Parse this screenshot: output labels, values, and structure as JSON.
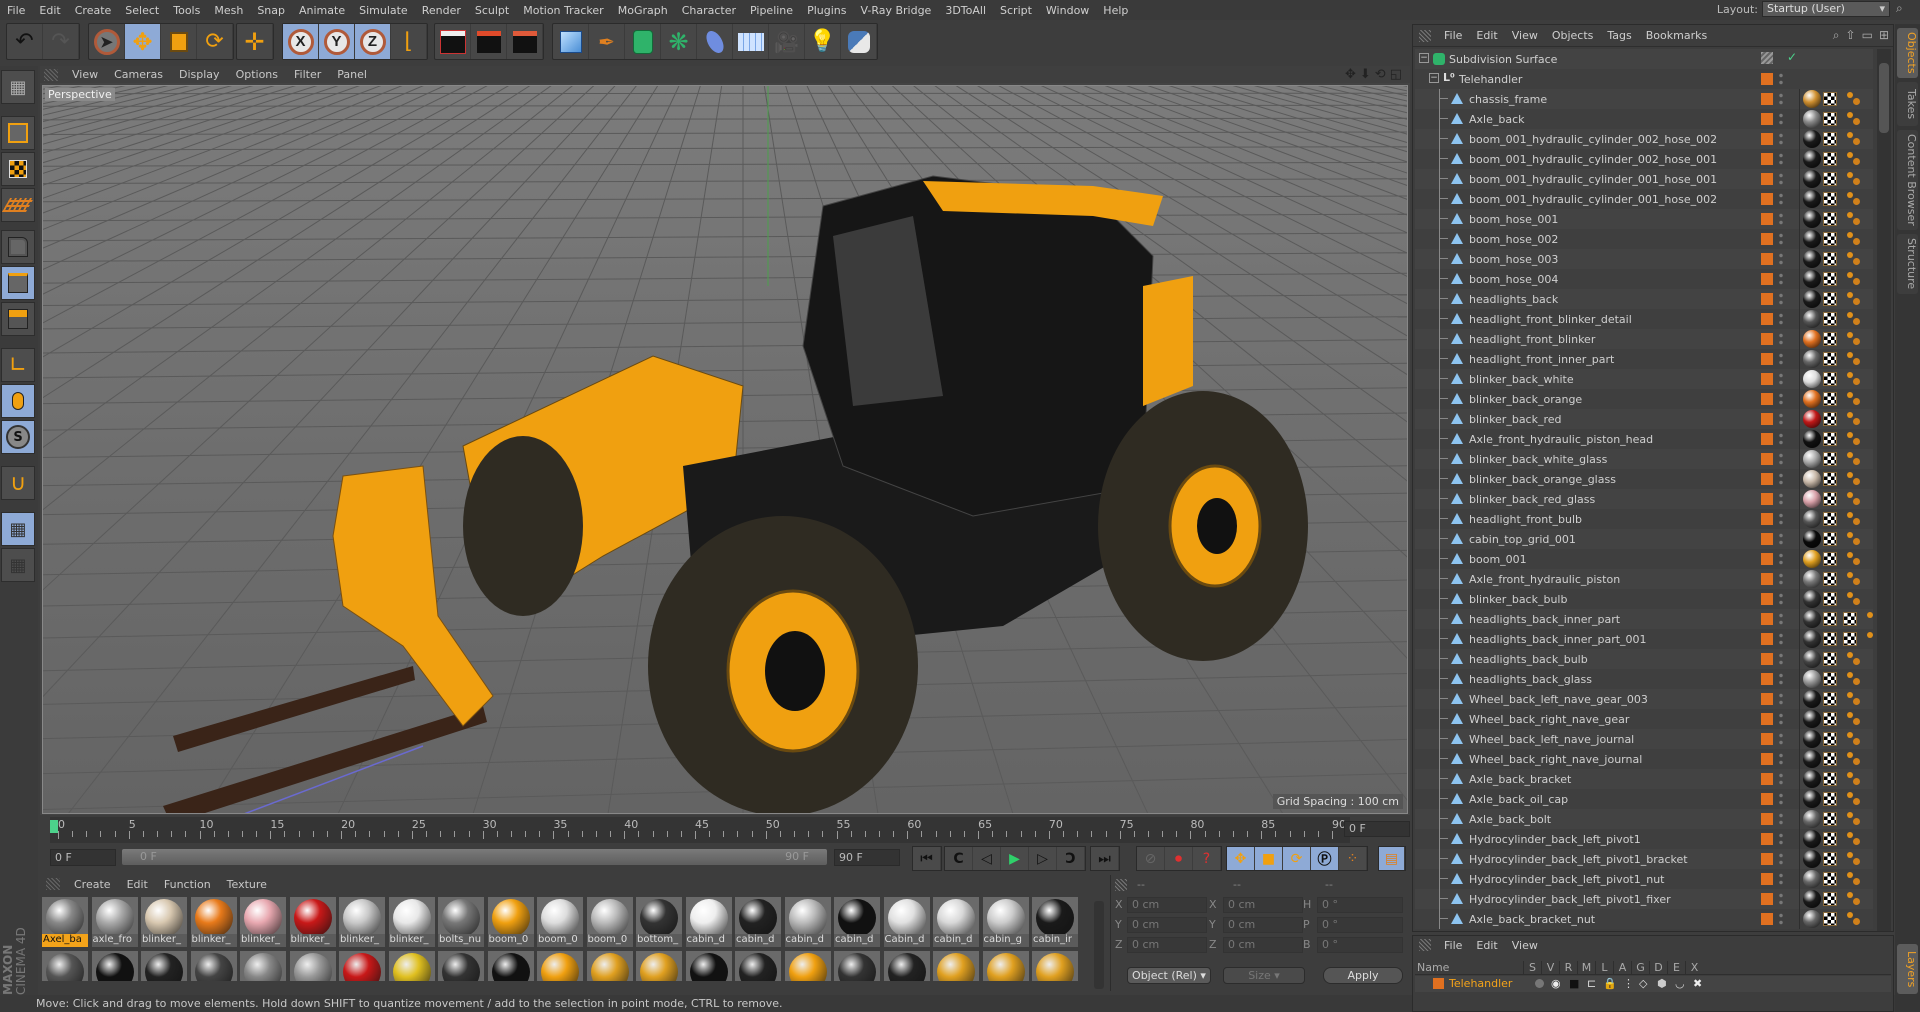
{
  "menubar": {
    "items": [
      "File",
      "Edit",
      "Create",
      "Select",
      "Tools",
      "Mesh",
      "Snap",
      "Animate",
      "Simulate",
      "Render",
      "Sculpt",
      "Motion Tracker",
      "MoGraph",
      "Character",
      "Pipeline",
      "Plugins",
      "V-Ray Bridge",
      "3DToAll",
      "Script",
      "Window",
      "Help"
    ],
    "layout_label": "Layout:",
    "layout_value": "Startup (User)"
  },
  "toolbar": {
    "undo": "undo-icon",
    "redo": "redo-icon",
    "tools": [
      "live-selection",
      "move",
      "scale",
      "rotate",
      "recent-tool"
    ],
    "axes": [
      "X",
      "Y",
      "Z"
    ],
    "coordinate_system": "world-coordinates",
    "render": [
      "render-view",
      "render-picture-viewer",
      "edit-render-settings"
    ],
    "objects": [
      "cube",
      "pen",
      "subdivision-surface",
      "cloner",
      "deformer",
      "floor",
      "camera",
      "light",
      "python"
    ]
  },
  "viewport": {
    "menu": [
      "View",
      "Cameras",
      "Display",
      "Options",
      "Filter",
      "Panel"
    ],
    "label": "Perspective",
    "grid_spacing": "Grid Spacing : 100 cm",
    "scene_description": "Yellow telehandler forklift 3D model on grid floor"
  },
  "left_toolbar": [
    "make-editable",
    "texture-mode",
    "uvw-mode",
    "points-mode",
    "edges-mode",
    "polygons-mode",
    "axis-mode",
    "tweak-mode",
    "solo-mode",
    "snapping",
    "workplane-lock",
    "workplane-mode"
  ],
  "timeline": {
    "ticks": [
      0,
      5,
      10,
      15,
      20,
      25,
      30,
      35,
      40,
      45,
      50,
      55,
      60,
      65,
      70,
      75,
      80,
      85,
      90
    ],
    "current_frame": "0 F",
    "start_frame": "0 F",
    "range_start": "0 F",
    "range_end": "90 F",
    "end_frame": "90 F"
  },
  "materials": {
    "menu": [
      "Create",
      "Edit",
      "Function",
      "Texture"
    ],
    "row1": [
      {
        "name": "Axel_ba",
        "selected": true,
        "color": "#888"
      },
      {
        "name": "axle_fro",
        "color": "#aaa"
      },
      {
        "name": "blinker_",
        "color": "#d8c8b0"
      },
      {
        "name": "blinker_",
        "color": "#e87a1a"
      },
      {
        "name": "blinker_",
        "color": "#e8a8b0"
      },
      {
        "name": "blinker_",
        "color": "#c81818"
      },
      {
        "name": "blinker_",
        "color": "#c8c8c8"
      },
      {
        "name": "blinker_",
        "color": "#e8e8e8"
      },
      {
        "name": "bolts_nu",
        "color": "#777"
      },
      {
        "name": "boom_0",
        "color": "#f0a010"
      },
      {
        "name": "boom_0",
        "color": "#ddd"
      },
      {
        "name": "boom_0",
        "color": "#bbb"
      },
      {
        "name": "bottom_",
        "color": "#333"
      },
      {
        "name": "cabin_d",
        "color": "#eee"
      },
      {
        "name": "cabin_d",
        "color": "#222"
      },
      {
        "name": "cabin_d",
        "color": "#bbb"
      },
      {
        "name": "cabin_d",
        "color": "#111"
      },
      {
        "name": "Cabin_d",
        "color": "#e0e0e0"
      },
      {
        "name": "cabin_d",
        "color": "#d8d8d8"
      },
      {
        "name": "cabin_g",
        "color": "#ccc"
      },
      {
        "name": "cabin_ir",
        "color": "#1a1a1a"
      }
    ],
    "row2_colors": [
      "#555",
      "#111",
      "#222",
      "#444",
      "#888",
      "#999",
      "#c81818",
      "#e0c020",
      "#333",
      "#111",
      "#f0a010",
      "#e0a020",
      "#e0a020",
      "#111",
      "#222",
      "#f0a010",
      "#333",
      "#222",
      "#e0a020",
      "#e0a020",
      "#e0a020",
      "#aaa"
    ]
  },
  "coordinates": {
    "col_headers": [
      "--",
      "--",
      "--"
    ],
    "rows": [
      {
        "l1": "X",
        "v1": "0 cm",
        "l2": "X",
        "v2": "0 cm",
        "l3": "H",
        "v3": "0 °"
      },
      {
        "l1": "Y",
        "v1": "0 cm",
        "l2": "Y",
        "v2": "0 cm",
        "l3": "P",
        "v3": "0 °"
      },
      {
        "l1": "Z",
        "v1": "0 cm",
        "l2": "Z",
        "v2": "0 cm",
        "l3": "B",
        "v3": "0 °"
      }
    ],
    "mode_select": "Object (Rel)",
    "size_select": "Size",
    "apply": "Apply"
  },
  "status": "Move: Click and drag to move elements. Hold down SHIFT to quantize movement / add to the selection in point mode, CTRL to remove.",
  "object_manager": {
    "menu": [
      "File",
      "Edit",
      "View",
      "Objects",
      "Tags",
      "Bookmarks"
    ],
    "root": "Subdivision Surface",
    "group": "Telehandler",
    "objects": [
      {
        "name": "chassis_frame",
        "mat": "#d09030"
      },
      {
        "name": "Axle_back",
        "mat": "#888"
      },
      {
        "name": "boom_001_hydraulic_cylinder_002_hose_002",
        "mat": "#1a1a1a"
      },
      {
        "name": "boom_001_hydraulic_cylinder_002_hose_001",
        "mat": "#1a1a1a"
      },
      {
        "name": "boom_001_hydraulic_cylinder_001_hose_001",
        "mat": "#1a1a1a"
      },
      {
        "name": "boom_001_hydraulic_cylinder_001_hose_002",
        "mat": "#1a1a1a"
      },
      {
        "name": "boom_hose_001",
        "mat": "#1a1a1a"
      },
      {
        "name": "boom_hose_002",
        "mat": "#1a1a1a"
      },
      {
        "name": "boom_hose_003",
        "mat": "#1a1a1a"
      },
      {
        "name": "boom_hose_004",
        "mat": "#1a1a1a"
      },
      {
        "name": "headlights_back",
        "mat": "#1a1a1a"
      },
      {
        "name": "headlight_front_blinker_detail",
        "mat": "#555"
      },
      {
        "name": "headlight_front_blinker",
        "mat": "#e07020"
      },
      {
        "name": "headlight_front_inner_part",
        "mat": "#666"
      },
      {
        "name": "blinker_back_white",
        "mat": "#ddd"
      },
      {
        "name": "blinker_back_orange",
        "mat": "#e07020"
      },
      {
        "name": "blinker_back_red",
        "mat": "#c01818"
      },
      {
        "name": "Axle_front_hydraulic_piston_head",
        "mat": "#111"
      },
      {
        "name": "blinker_back_white_glass",
        "mat": "#aaa"
      },
      {
        "name": "blinker_back_orange_glass",
        "mat": "#c8b8a8"
      },
      {
        "name": "blinker_back_red_glass",
        "mat": "#d8a0a8"
      },
      {
        "name": "headlight_front_bulb",
        "mat": "#555"
      },
      {
        "name": "cabin_top_grid_001",
        "mat": "#0a0a0a"
      },
      {
        "name": "boom_001",
        "mat": "#e0a020"
      },
      {
        "name": "Axle_front_hydraulic_piston",
        "mat": "#777"
      },
      {
        "name": "blinker_back_bulb",
        "mat": "#333"
      },
      {
        "name": "headlights_back_inner_part",
        "mat": "#333",
        "extra_uvw": true
      },
      {
        "name": "headlights_back_inner_part_001",
        "mat": "#333",
        "extra_uvw": true
      },
      {
        "name": "headlights_back_bulb",
        "mat": "#444"
      },
      {
        "name": "headlights_back_glass",
        "mat": "#999"
      },
      {
        "name": "Wheel_back_left_nave_gear_003",
        "mat": "#1a1a1a"
      },
      {
        "name": "Wheel_back_right_nave_gear",
        "mat": "#1a1a1a"
      },
      {
        "name": "Wheel_back_left_nave_journal",
        "mat": "#1a1a1a"
      },
      {
        "name": "Wheel_back_right_nave_journal",
        "mat": "#1a1a1a"
      },
      {
        "name": "Axle_back_bracket",
        "mat": "#1a1a1a"
      },
      {
        "name": "Axle_back_oil_cap",
        "mat": "#1a1a1a"
      },
      {
        "name": "Axle_back_bolt",
        "mat": "#666"
      },
      {
        "name": "Hydrocylinder_back_left_pivot1",
        "mat": "#1a1a1a"
      },
      {
        "name": "Hydrocylinder_back_left_pivot1_bracket",
        "mat": "#1a1a1a"
      },
      {
        "name": "Hydrocylinder_back_left_pivot1_nut",
        "mat": "#666"
      },
      {
        "name": "Hydrocylinder_back_left_pivot1_fixer",
        "mat": "#1a1a1a"
      },
      {
        "name": "Axle_back_bracket_nut",
        "mat": "#666"
      }
    ]
  },
  "layer_manager": {
    "menu": [
      "File",
      "Edit",
      "View"
    ],
    "columns": [
      "Name",
      "S",
      "V",
      "R",
      "M",
      "L",
      "A",
      "G",
      "D",
      "E",
      "X"
    ],
    "layer": "Telehandler"
  },
  "right_tabs": [
    "Objects",
    "Takes",
    "Content Browser",
    "Structure"
  ],
  "right_tabs_bottom": [
    "Layers"
  ],
  "branding": [
    "MAXON",
    "CINEMA 4D"
  ],
  "colors": {
    "accent": "#f3a31a",
    "active_tool": "#8eaad6",
    "layer": "#e07020",
    "playhead": "#4cd28b"
  }
}
